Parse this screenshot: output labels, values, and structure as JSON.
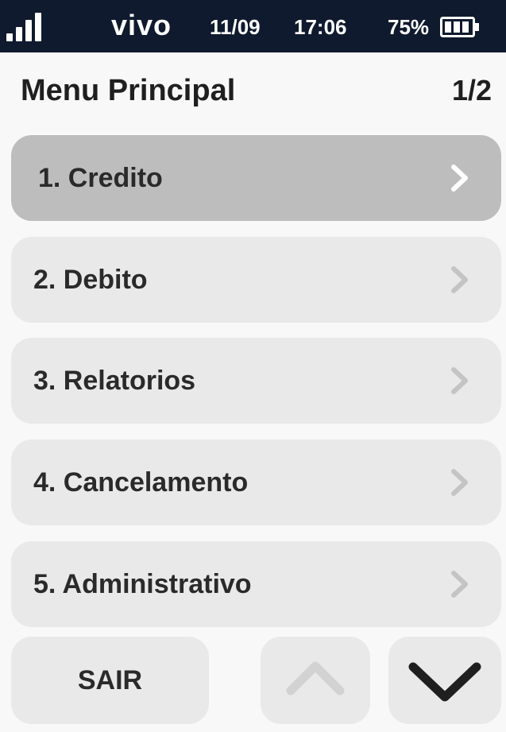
{
  "status_bar": {
    "carrier": "vivo",
    "date": "11/09",
    "time": "17:06",
    "battery_percent": "75%",
    "signal_icon": "signal-bars-icon",
    "battery_icon": "battery-icon"
  },
  "header": {
    "title": "Menu Principal",
    "page_indicator": "1/2"
  },
  "menu": {
    "selected_index": 0,
    "items": [
      {
        "label": "1. Credito"
      },
      {
        "label": "2. Debito"
      },
      {
        "label": "3. Relatorios"
      },
      {
        "label": "4. Cancelamento"
      },
      {
        "label": "5. Administrativo"
      }
    ]
  },
  "footer": {
    "exit_label": "SAIR",
    "up_icon": "chevron-up-icon",
    "down_icon": "chevron-down-icon"
  },
  "colors": {
    "status_bar_bg": "#101a2e",
    "item_bg": "#e9e9e9",
    "item_selected_bg": "#bdbdbd",
    "chevron": "#c4c4c4",
    "text": "#2a2a2a"
  }
}
